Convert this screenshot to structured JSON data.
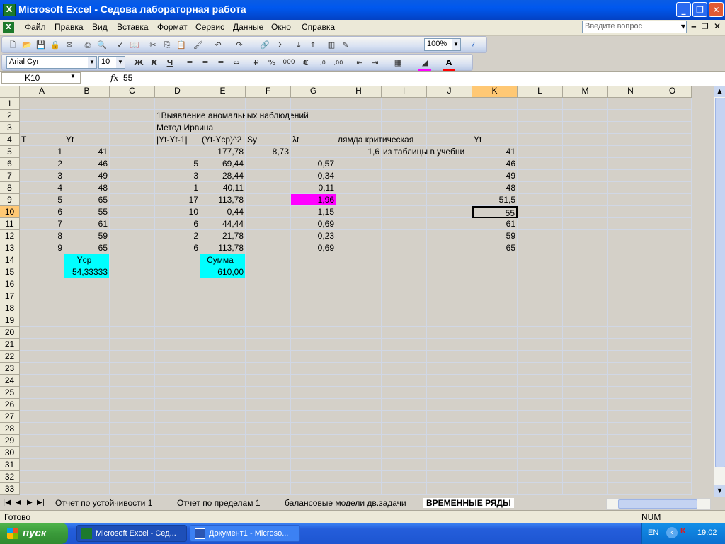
{
  "window": {
    "title": "Microsoft Excel - Седова лабораторная работа"
  },
  "menu": {
    "items": [
      "Файл",
      "Правка",
      "Вид",
      "Вставка",
      "Формат",
      "Сервис",
      "Данные",
      "Окно",
      "Справка"
    ],
    "ask_placeholder": "Введите вопрос"
  },
  "toolbar": {
    "zoom": "100%",
    "font": "Arial Cyr",
    "size": "10"
  },
  "formula": {
    "namebox": "K10",
    "fx": "fx",
    "value": "55"
  },
  "columns": [
    "A",
    "B",
    "C",
    "D",
    "E",
    "F",
    "G",
    "H",
    "I",
    "J",
    "K",
    "L",
    "M",
    "N",
    "O"
  ],
  "rows": [
    "1",
    "2",
    "3",
    "4",
    "5",
    "6",
    "7",
    "8",
    "9",
    "10",
    "11",
    "12",
    "13",
    "14",
    "15",
    "16",
    "17",
    "18",
    "19",
    "20",
    "21",
    "22",
    "23",
    "24",
    "25",
    "26",
    "27",
    "28",
    "29",
    "30",
    "31",
    "32",
    "33"
  ],
  "cells": {
    "D2": "1Выявление аномальных наблюдений",
    "D3": "Метод Ирвина",
    "A4": "T",
    "B4": "Yt",
    "D4": "|Yt-Yt-1|",
    "E4": "(Yt-Ycp)^2",
    "F4": "Sy",
    "G4": "λt",
    "H4": "лямда критическая",
    "K4": "Yt",
    "A5": "1",
    "B5": "41",
    "E5": "177,78",
    "F5": "8,73",
    "H5": "1,6",
    "I5": "из таблицы в учебни",
    "K5": "41",
    "A6": "2",
    "B6": "46",
    "D6": "5",
    "E6": "69,44",
    "G6": "0,57",
    "K6": "46",
    "A7": "3",
    "B7": "49",
    "D7": "3",
    "E7": "28,44",
    "G7": "0,34",
    "K7": "49",
    "A8": "4",
    "B8": "48",
    "D8": "1",
    "E8": "40,11",
    "G8": "0,11",
    "K8": "48",
    "A9": "5",
    "B9": "65",
    "D9": "17",
    "E9": "113,78",
    "G9": "1,96",
    "K9": "51,5",
    "A10": "6",
    "B10": "55",
    "D10": "10",
    "E10": "0,44",
    "G10": "1,15",
    "K10": "55",
    "A11": "7",
    "B11": "61",
    "D11": "6",
    "E11": "44,44",
    "G11": "0,69",
    "K11": "61",
    "A12": "8",
    "B12": "59",
    "D12": "2",
    "E12": "21,78",
    "G12": "0,23",
    "K12": "59",
    "A13": "9",
    "B13": "65",
    "D13": "6",
    "E13": "113,78",
    "G13": "0,69",
    "K13": "65",
    "B14": "Ycp=",
    "E14": "Сумма=",
    "B15": "54,33333",
    "E15": "610,00"
  },
  "sheets": [
    "Отчет по устойчивости 1",
    "Отчет по пределам 1",
    "балансовые модели дв.задачи",
    "ВРЕМЕННЫЕ РЯДЫ"
  ],
  "status": {
    "left": "Готово",
    "num": "NUM"
  },
  "taskbar": {
    "start": "пуск",
    "tasks": [
      "Microsoft Excel - Сед...",
      "Документ1 - Microso..."
    ],
    "lang": "EN",
    "clock": "19:02"
  },
  "colors": {
    "highlight_magenta": "#ff00ff",
    "highlight_cyan": "#00ffff",
    "selected_header": "#ffc874"
  }
}
